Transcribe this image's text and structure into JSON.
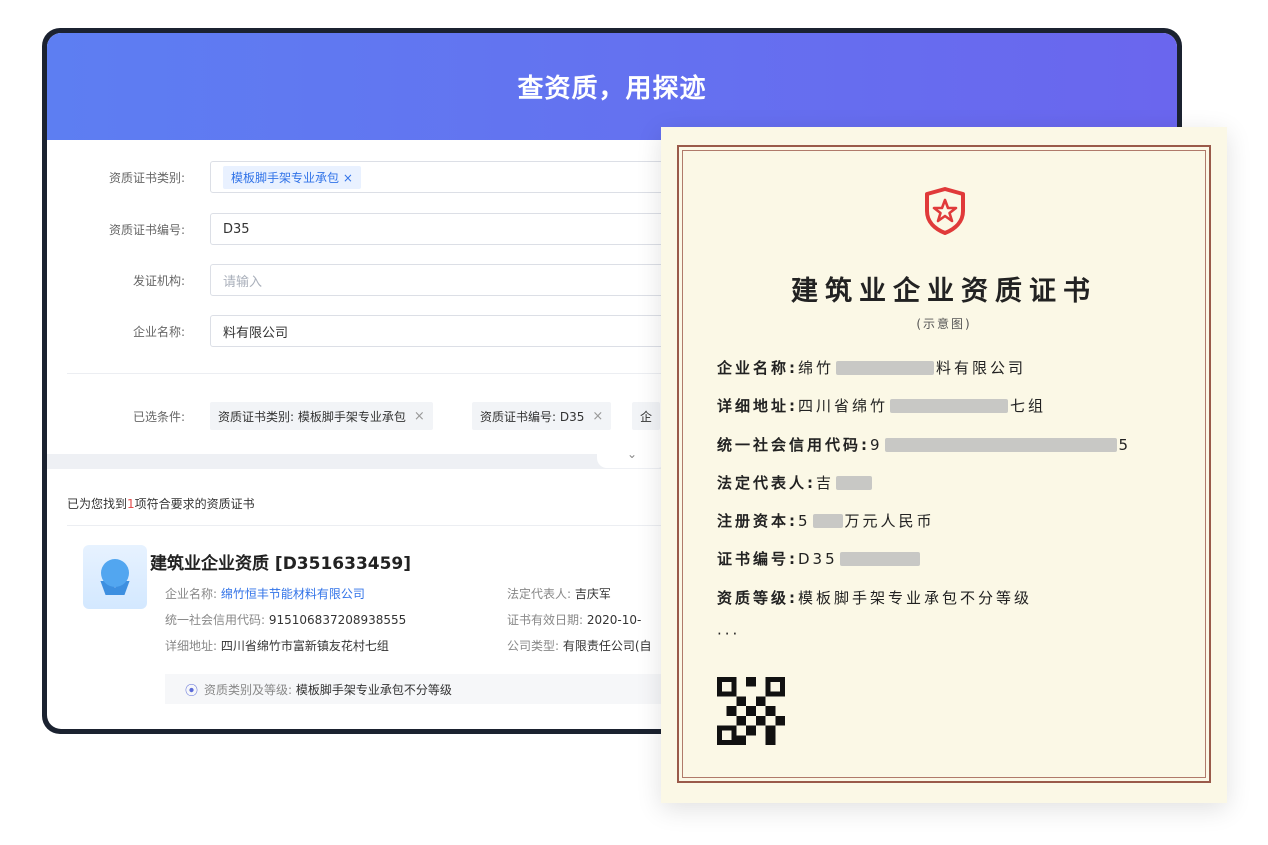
{
  "hero_title": "查资质，用探迹",
  "form": {
    "cert_type_label": "资质证书类别:",
    "cert_type_tag": "模板脚手架专业承包",
    "cert_type_tag_close": "×",
    "cert_no_label": "资质证书编号:",
    "cert_no_value": "D35",
    "issuer_label": "发证机构:",
    "issuer_placeholder": "请输入",
    "company_label": "企业名称:",
    "company_value": "料有限公司"
  },
  "selected": {
    "label": "已选条件:",
    "chips": [
      {
        "text": "资质证书类别: 模板脚手架专业承包",
        "close": "×"
      },
      {
        "text": "资质证书编号: D35",
        "close": "×"
      },
      {
        "text": "企",
        "close": ""
      }
    ],
    "expand_icon": "chevron-down-icon",
    "expand_glyph": "⌄"
  },
  "results": {
    "found_prefix": "已为您找到",
    "found_count": "1",
    "found_suffix": "项符合要求的资质证书",
    "title": "建筑业企业资质 [D351633459]",
    "company_label": "企业名称:",
    "company_value": "绵竹恒丰节能材料有限公司",
    "legal_rep_label": "法定代表人:",
    "legal_rep_value": "吉庆军",
    "credit_code_label": "统一社会信用代码:",
    "credit_code_value": "915106837208938555",
    "valid_date_label": "证书有效日期:",
    "valid_date_value": "2020-10-",
    "address_label": "详细地址:",
    "address_value": "四川省绵竹市富新镇友花村七组",
    "company_type_label": "公司类型:",
    "company_type_value": "有限责任公司(自",
    "qual_label": "资质类别及等级:",
    "qual_value": "模板脚手架专业承包不分等级"
  },
  "certificate": {
    "title": "建筑业企业资质证书",
    "subtitle": "(示意图)",
    "company_k": "企业名称:",
    "company_pre": "绵竹",
    "company_post": "料有限公司",
    "address_k": "详细地址:",
    "address_pre": "四川省绵竹",
    "address_post": "七组",
    "credit_k": "统一社会信用代码:",
    "credit_pre": "9",
    "credit_post": "5",
    "legal_k": "法定代表人:",
    "legal_pre": "吉",
    "capital_k": "注册资本:",
    "capital_pre": "5",
    "capital_post": "万元人民币",
    "certno_k": "证书编号:",
    "certno_pre": "D35",
    "level_k": "资质等级:",
    "level_v": "模板脚手架专业承包不分等级",
    "ellipsis": "···",
    "brand_red": "#e03a3a",
    "border_color": "#9a5a4a"
  }
}
